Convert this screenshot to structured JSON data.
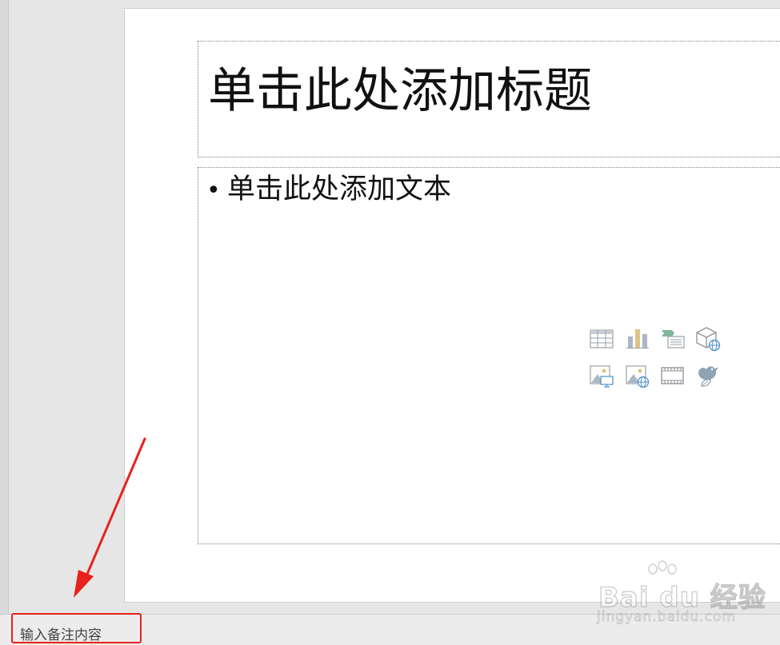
{
  "slide": {
    "title_placeholder": "单击此处添加标题",
    "body_placeholder": "单击此处添加文本",
    "bullet": "•"
  },
  "insert_icons": [
    "table-icon",
    "chart-icon",
    "smartart-icon",
    "3d-model-icon",
    "picture-icon",
    "online-picture-icon",
    "video-icon",
    "icons-icon"
  ],
  "notes": {
    "placeholder": "输入备注内容"
  },
  "annotation": {
    "color": "#e8211d"
  },
  "watermark": {
    "brand": "Bai du 经验",
    "url": "jingyan.baidu.com"
  }
}
